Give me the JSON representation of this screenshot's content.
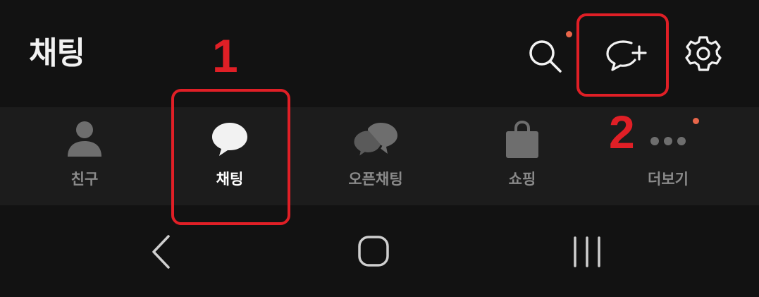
{
  "header": {
    "title": "채팅",
    "icons": [
      "search-icon",
      "new-chat-icon",
      "gear-icon"
    ]
  },
  "tabs": [
    {
      "label": "친구",
      "icon": "person-icon",
      "active": false
    },
    {
      "label": "채팅",
      "icon": "chat-bubble-icon",
      "active": true
    },
    {
      "label": "오픈채팅",
      "icon": "open-chat-icon",
      "active": false
    },
    {
      "label": "쇼핑",
      "icon": "shopping-bag-icon",
      "active": false
    },
    {
      "label": "더보기",
      "icon": "more-dots-icon",
      "active": false
    }
  ],
  "system_nav": {
    "buttons": [
      "back-icon",
      "home-icon",
      "recent-apps-icon"
    ]
  },
  "annotations": {
    "label_1": "1",
    "label_2": "2"
  },
  "colors": {
    "background": "#121212",
    "tabbar": "#1c1c1c",
    "notification_dot": "#e8664a",
    "annotation": "#e01f26",
    "active_text": "#ffffff",
    "inactive_text": "#8a8a8a"
  }
}
